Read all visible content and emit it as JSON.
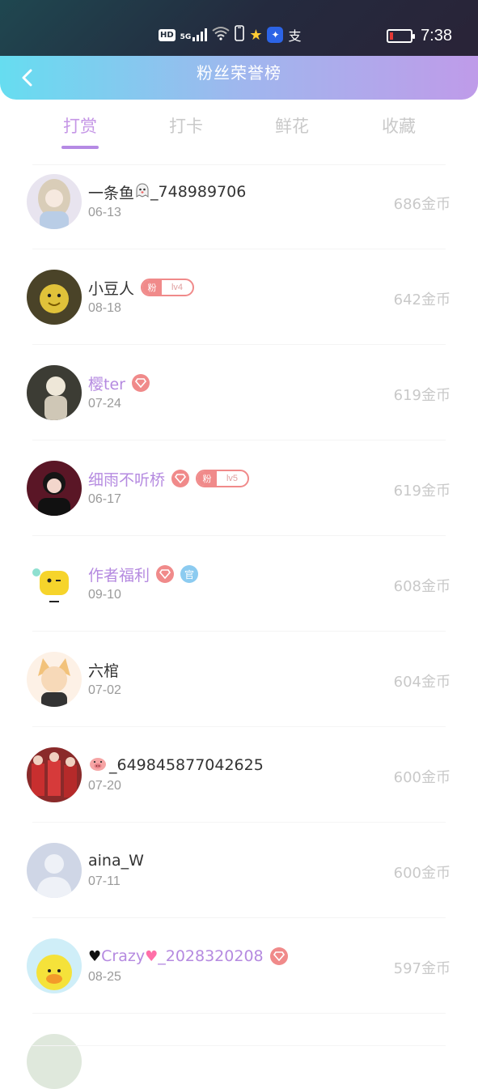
{
  "status_bar": {
    "hd": "HD",
    "network": "5G",
    "time": "7:38"
  },
  "header": {
    "title": "粉丝荣誉榜"
  },
  "tabs": [
    {
      "label": "打赏",
      "active": true
    },
    {
      "label": "打卡",
      "active": false
    },
    {
      "label": "鲜花",
      "active": false
    },
    {
      "label": "收藏",
      "active": false
    }
  ],
  "rows": [
    {
      "name": "一条鱼",
      "name_suffix": "_748989706",
      "date": "06-13",
      "coins": "686金币"
    },
    {
      "name": "小豆人",
      "date": "08-18",
      "coins": "642金币",
      "fan_badge": {
        "tag": "粉",
        "level": "lv4"
      }
    },
    {
      "name": "樱ter",
      "date": "07-24",
      "coins": "619金币"
    },
    {
      "name": "细雨不听桥",
      "date": "06-17",
      "coins": "619金币",
      "fan_badge": {
        "tag": "粉",
        "level": "lv5"
      }
    },
    {
      "name": "作者福利",
      "date": "09-10",
      "coins": "608金币",
      "guan_badge": "官"
    },
    {
      "name": "六棺",
      "date": "07-02",
      "coins": "604金币"
    },
    {
      "name": "_649845877042625",
      "date": "07-20",
      "coins": "600金币"
    },
    {
      "name": "aina_W",
      "date": "07-11",
      "coins": "600金币"
    },
    {
      "name": "Crazy",
      "name_suffix": "_2028320208",
      "date": "08-25",
      "coins": "597金币"
    }
  ],
  "colors": {
    "accent_purple": "#b58ae4",
    "badge_red": "#f08a8a",
    "header_gradient_start": "#66ddf0",
    "header_gradient_end": "#bf9be9"
  },
  "icons": [
    "back-arrow-icon",
    "diamond-icon",
    "wifi-icon",
    "signal-icon",
    "battery-icon"
  ]
}
